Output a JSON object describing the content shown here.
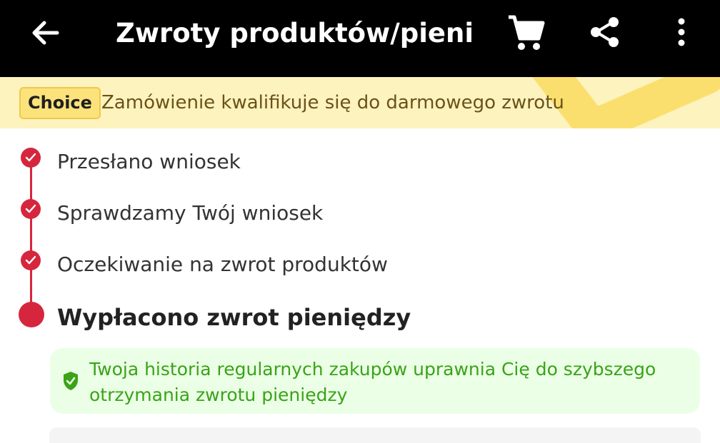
{
  "app_bar": {
    "title": "Zwroty produktów/pienię...",
    "back_icon": "arrow-left-icon",
    "cart_icon": "cart-icon",
    "share_icon": "share-icon",
    "more_icon": "more-vertical-icon",
    "background": "#000000"
  },
  "banner": {
    "badge": "Choice",
    "text": "Zamówienie kwalifikuje się do darmowego zwrotu",
    "background": "#fdf3bf"
  },
  "timeline": {
    "accent_color": "#d6263e",
    "steps": [
      {
        "label": "Przesłano wniosek",
        "done": true
      },
      {
        "label": "Sprawdzamy Twój wniosek",
        "done": true
      },
      {
        "label": "Oczekiwanie na zwrot produktów",
        "done": true
      }
    ],
    "current_step": "Wypłacono zwrot pieniędzy"
  },
  "info": {
    "icon": "shield-check-icon",
    "text": "Twoja historia regularnych zakupów uprawnia Cię do szybszego otrzymania zwrotu pieniędzy",
    "color": "#3aa318"
  }
}
